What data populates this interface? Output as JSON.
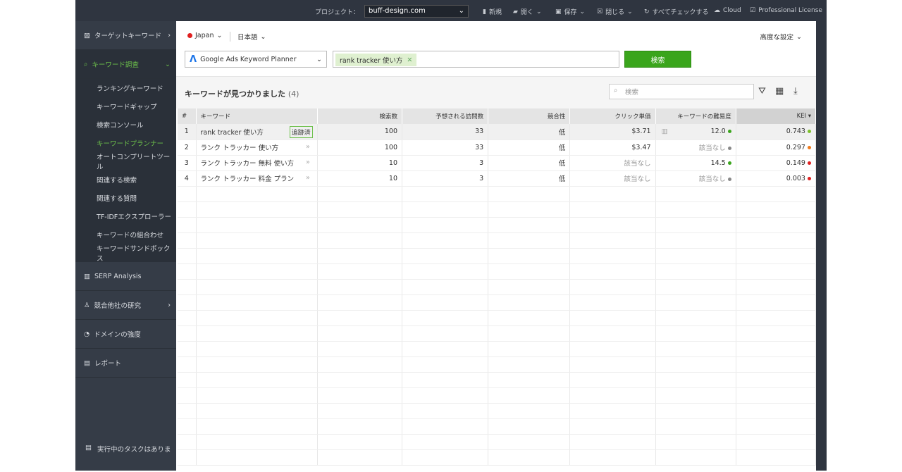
{
  "topbar": {
    "project_label": "プロジェクト：",
    "project": "buff-design.com",
    "new": "新規",
    "open": "開く",
    "save": "保存",
    "close": "閉じる",
    "check_all": "すべてチェックする",
    "cloud": "Cloud",
    "license": "Professional License"
  },
  "sidebar": {
    "target": "ターゲットキーワード",
    "research": "キーワード調査",
    "subs": [
      "ランキングキーワード",
      "キーワードギャップ",
      "検索コンソール",
      "キーワードプランナー",
      "オートコンプリートツール",
      "関連する検索",
      "関連する質問",
      "TF-IDFエクスプローラー",
      "キーワードの組合わせ",
      "キーワードサンドボックス"
    ],
    "serp": "SERP Analysis",
    "competitors": "競合他社の研究",
    "domain": "ドメインの強度",
    "report": "レポート",
    "tasks": "実行中のタスクはありま"
  },
  "main": {
    "country": "Japan",
    "language": "日本語",
    "advanced": "高度な設定",
    "source": "Google Ads Keyword Planner",
    "chip": "rank tracker 使い方",
    "search_button": "検索",
    "found": "キーワードが見つかりました",
    "found_count": "(4)",
    "search_placeholder": "検索"
  },
  "table": {
    "headers": [
      "#",
      "キーワード",
      "検索数",
      "予想される訪問数",
      "競合性",
      "クリック単価",
      "キーワードの難易度",
      "KEI ▾"
    ],
    "tracked_label": "追跡済",
    "rows": [
      {
        "n": "1",
        "kw": "rank tracker 使い方",
        "vol": "100",
        "visits": "33",
        "comp": "低",
        "cpc": "$3.71",
        "diff": "12.0",
        "diff_color": "#3aa51c",
        "kei": "0.743",
        "kei_color": "#7cc02a"
      },
      {
        "n": "2",
        "kw": "ランク トラッカー 使い方",
        "vol": "100",
        "visits": "33",
        "comp": "低",
        "cpc": "$3.47",
        "diff": "該当なし",
        "diff_color": "#888",
        "kei": "0.297",
        "kei_color": "#f07a1a"
      },
      {
        "n": "3",
        "kw": "ランク トラッカー 無料 使い方",
        "vol": "10",
        "visits": "3",
        "comp": "低",
        "cpc": "該当なし",
        "diff": "14.5",
        "diff_color": "#3aa51c",
        "kei": "0.149",
        "kei_color": "#e02020"
      },
      {
        "n": "4",
        "kw": "ランク トラッカー 料金 プラン",
        "vol": "10",
        "visits": "3",
        "comp": "低",
        "cpc": "該当なし",
        "diff": "該当なし",
        "diff_color": "#888",
        "kei": "0.003",
        "kei_color": "#e02020"
      }
    ]
  }
}
